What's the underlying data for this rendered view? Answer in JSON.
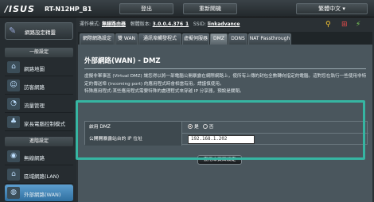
{
  "header": {
    "brand": "/ISUS",
    "model": "RT-N12HP_B1",
    "logout_label": "登出",
    "reboot_label": "重新開機",
    "language_label": "繁體中文"
  },
  "status": {
    "mode_label": "運作模式:",
    "mode_value": "無線路由器",
    "firmware_label": "韌體版本:",
    "firmware_value": "3.0.0.4.376_1",
    "ssid_label": "SSID:",
    "ssid_value": "linkadvance"
  },
  "sidebar": {
    "qis_label": "網路設定精靈",
    "general_header": "一般設定",
    "general_items": [
      {
        "label": "網路地圖",
        "icon": "network-map-icon"
      },
      {
        "label": "訪客網路",
        "icon": "guest-network-icon"
      },
      {
        "label": "流量管理",
        "icon": "traffic-icon"
      },
      {
        "label": "家長電腦控制模式",
        "icon": "parental-control-icon"
      }
    ],
    "advanced_header": "進階設定",
    "advanced_items": [
      {
        "label": "無線網路",
        "icon": "wireless-icon"
      },
      {
        "label": "區域網路(LAN)",
        "icon": "lan-icon"
      },
      {
        "label": "外部網路(WAN)",
        "icon": "wan-icon"
      }
    ]
  },
  "tabs": [
    "網際網路設定",
    "雙 WAN",
    "通訊埠觸發程式",
    "虛擬伺服器",
    "DMZ",
    "DDNS",
    "NAT Passthrough"
  ],
  "active_tab": 4,
  "page": {
    "title": "外部網路(WAN) - DMZ",
    "description_1": "虛擬非軍事區 (Virtual DMZ) 讓您得以將一部電腦公開暴露在網際網路上，使所有上傳的封包全數轉向指定的電腦。這對您在執行一些使用非特定的傳送埠 (incoming port) 的應用程式時會相當有用。請謹慎使用。",
    "description_2": "特殊應用程式:某些應用程式需要特殊的處理程式來穿越 IP 分享器，預設是關閉。",
    "enable_label": "啟用 DMZ",
    "enable_yes": "是",
    "enable_no": "否",
    "ip_label": "公開開暴露站台的 IP 位址",
    "ip_value": "192.168.1.202",
    "apply_label": "套用本頁面設定"
  },
  "colors": {
    "highlight": "#36b5a2",
    "active_nav": "#3f85bd"
  }
}
